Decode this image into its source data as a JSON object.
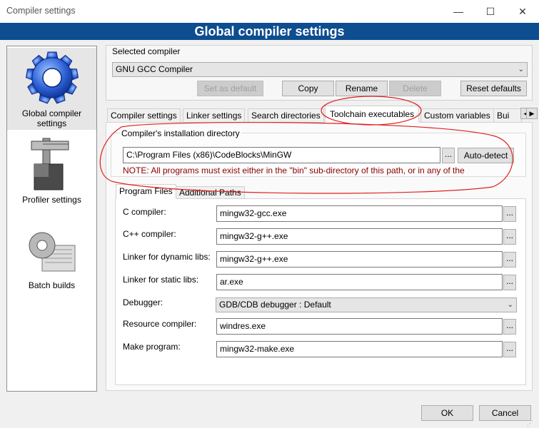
{
  "window": {
    "title": "Compiler settings",
    "banner": "Global compiler settings"
  },
  "sidebar": {
    "items": [
      {
        "label": "Global compiler settings"
      },
      {
        "label": "Profiler settings"
      },
      {
        "label": "Batch builds"
      }
    ]
  },
  "compiler": {
    "selected_label": "Selected compiler",
    "selected_value": "GNU GCC Compiler",
    "buttons": {
      "set_default": "Set as default",
      "copy": "Copy",
      "rename": "Rename",
      "delete": "Delete",
      "reset": "Reset defaults"
    }
  },
  "tabs": [
    {
      "label": "Compiler settings"
    },
    {
      "label": "Linker settings"
    },
    {
      "label": "Search directories"
    },
    {
      "label": "Toolchain executables"
    },
    {
      "label": "Custom variables"
    },
    {
      "label": "Bui"
    }
  ],
  "toolchain": {
    "install_label": "Compiler's installation directory",
    "install_dir": "C:\\Program Files (x86)\\CodeBlocks\\MinGW",
    "dots": "...",
    "autodetect": "Auto-detect",
    "note": "NOTE: All programs must exist either in the \"bin\" sub-directory of this path, or in any of the",
    "subtabs": [
      {
        "label": "Program Files"
      },
      {
        "label": "Additional Paths"
      }
    ],
    "programs": [
      {
        "label": "C compiler:",
        "value": "mingw32-gcc.exe"
      },
      {
        "label": "C++ compiler:",
        "value": "mingw32-g++.exe"
      },
      {
        "label": "Linker for dynamic libs:",
        "value": "mingw32-g++.exe"
      },
      {
        "label": "Linker for static libs:",
        "value": "ar.exe"
      },
      {
        "label": "Debugger:",
        "value": "GDB/CDB debugger : Default"
      },
      {
        "label": "Resource compiler:",
        "value": "windres.exe"
      },
      {
        "label": "Make program:",
        "value": "mingw32-make.exe"
      }
    ]
  },
  "footer": {
    "ok": "OK",
    "cancel": "Cancel"
  },
  "colors": {
    "banner": "#0d4d90",
    "note": "#8b0000",
    "annotation": "#e02020"
  }
}
